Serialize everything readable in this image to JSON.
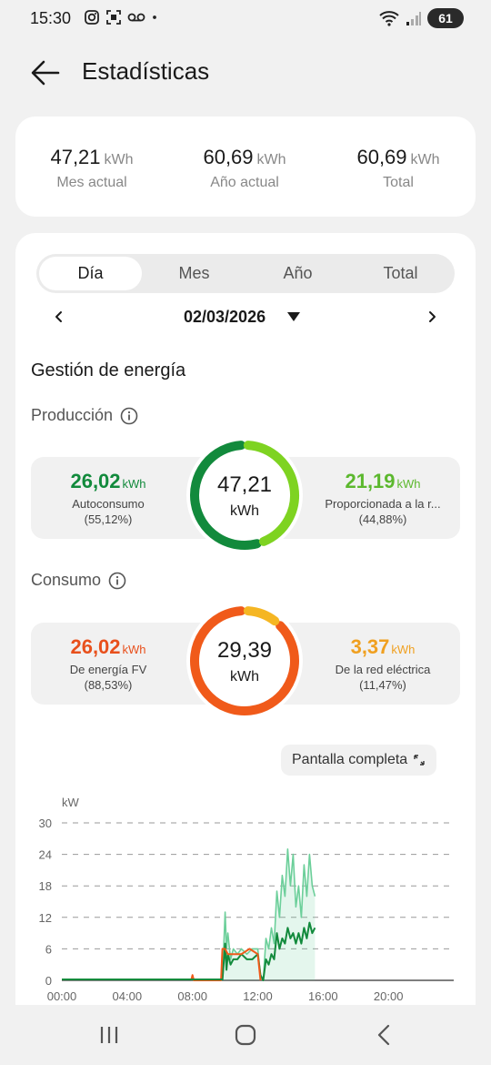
{
  "status": {
    "time": "15:30",
    "battery": "61"
  },
  "header": {
    "title": "Estadísticas"
  },
  "summary": [
    {
      "value": "47,21",
      "unit": "kWh",
      "label": "Mes actual"
    },
    {
      "value": "60,69",
      "unit": "kWh",
      "label": "Año actual"
    },
    {
      "value": "60,69",
      "unit": "kWh",
      "label": "Total"
    }
  ],
  "tabs": [
    "Día",
    "Mes",
    "Año",
    "Total"
  ],
  "active_tab": "Día",
  "date": "02/03/2026",
  "section_title": "Gestión de energía",
  "production": {
    "title": "Producción",
    "left": {
      "value": "26,02",
      "unit": "kWh",
      "label": "Autoconsumo",
      "pct": "(55,12%)"
    },
    "right": {
      "value": "21,19",
      "unit": "kWh",
      "label": "Proporcionada a la r...",
      "pct": "(44,88%)"
    },
    "center": {
      "value": "47,21",
      "unit": "kWh"
    },
    "split_fraction": 0.5512
  },
  "consumption": {
    "title": "Consumo",
    "left": {
      "value": "26,02",
      "unit": "kWh",
      "label": "De energía FV",
      "pct": "(88,53%)"
    },
    "right": {
      "value": "3,37",
      "unit": "kWh",
      "label": "De la red eléctrica",
      "pct": "(11,47%)"
    },
    "center": {
      "value": "29,39",
      "unit": "kWh"
    },
    "split_fraction": 0.8853
  },
  "colors": {
    "prod_dark": "#128a3c",
    "prod_light": "#7ed321",
    "cons_orange": "#f05a1a",
    "cons_yellow": "#f5b623",
    "text_green_dark": "#128a3c",
    "text_green_light": "#5cb82e",
    "text_orange": "#e8501c",
    "text_yellow": "#f0a020"
  },
  "fullscreen_label": "Pantalla completa",
  "chart_data": {
    "type": "line",
    "ylabel": "kW",
    "ylim": [
      0,
      30
    ],
    "yticks": [
      0,
      6,
      12,
      18,
      24,
      30
    ],
    "xticks": [
      "00:00",
      "04:00",
      "08:00",
      "12:00",
      "16:00",
      "20:00"
    ],
    "series": [
      {
        "color": "#6ccf9a",
        "fill": true,
        "x": [
          "09:50",
          "10:00",
          "10:05",
          "10:10",
          "10:20",
          "10:30",
          "10:45",
          "11:00",
          "11:20",
          "11:40",
          "12:00",
          "12:10",
          "12:20",
          "12:30",
          "12:40",
          "12:50",
          "13:00",
          "13:10",
          "13:20",
          "13:30",
          "13:40",
          "13:50",
          "14:00",
          "14:10",
          "14:20",
          "14:30",
          "14:40",
          "14:50",
          "15:00",
          "15:10",
          "15:20",
          "15:30"
        ],
        "values": [
          0,
          13,
          6,
          9,
          4,
          6,
          5,
          6,
          5,
          6,
          6,
          1,
          0,
          8,
          6,
          10,
          7,
          17,
          12,
          20,
          16,
          25,
          18,
          24,
          14,
          18,
          12,
          22,
          16,
          24,
          18,
          16
        ]
      },
      {
        "color": "#128a3c",
        "fill": false,
        "x": [
          "09:50",
          "10:00",
          "10:05",
          "10:10",
          "10:20",
          "10:30",
          "10:45",
          "11:00",
          "11:20",
          "11:40",
          "12:00",
          "12:10",
          "12:20",
          "12:30",
          "12:40",
          "12:50",
          "13:00",
          "13:10",
          "13:20",
          "13:30",
          "13:40",
          "13:50",
          "14:00",
          "14:10",
          "14:20",
          "14:30",
          "14:40",
          "14:50",
          "15:00",
          "15:10",
          "15:20",
          "15:30"
        ],
        "values": [
          0,
          7,
          2,
          5,
          3,
          4,
          4,
          5,
          4,
          4,
          5,
          1,
          0,
          4,
          3,
          5,
          4,
          9,
          6,
          8,
          7,
          10,
          8,
          9,
          7,
          9,
          7,
          10,
          8,
          11,
          9,
          10
        ]
      },
      {
        "color": "#f05a1a",
        "fill": false,
        "x": [
          "07:55",
          "08:00",
          "08:05",
          "09:45",
          "09:50",
          "10:00",
          "10:10",
          "10:30",
          "11:00",
          "11:30",
          "12:00",
          "12:10"
        ],
        "values": [
          0,
          1,
          0,
          0,
          6,
          6,
          5,
          5,
          5,
          6,
          5,
          0
        ]
      }
    ]
  }
}
